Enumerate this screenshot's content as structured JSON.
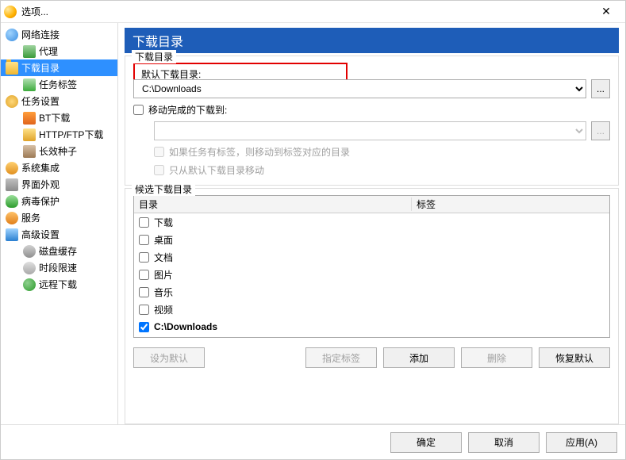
{
  "title": "选项...",
  "close_glyph": "✕",
  "sidebar": {
    "items": [
      {
        "label": "网络连接",
        "icon": "ic-globe",
        "level": 0
      },
      {
        "label": "代理",
        "icon": "ic-proxy",
        "level": 1
      },
      {
        "label": "下载目录",
        "icon": "ic-folder",
        "level": 0,
        "selected": true
      },
      {
        "label": "任务标签",
        "icon": "ic-tag",
        "level": 1
      },
      {
        "label": "任务设置",
        "icon": "ic-gear",
        "level": 0
      },
      {
        "label": "BT下载",
        "icon": "ic-bt",
        "level": 1
      },
      {
        "label": "HTTP/FTP下载",
        "icon": "ic-http",
        "level": 1
      },
      {
        "label": "长效种子",
        "icon": "ic-seed",
        "level": 1
      },
      {
        "label": "系统集成",
        "icon": "ic-users",
        "level": 0
      },
      {
        "label": "界面外观",
        "icon": "ic-ui",
        "level": 0
      },
      {
        "label": "病毒保护",
        "icon": "ic-shield",
        "level": 0
      },
      {
        "label": "服务",
        "icon": "ic-svc",
        "level": 0
      },
      {
        "label": "高级设置",
        "icon": "ic-adv",
        "level": 0
      },
      {
        "label": "磁盘缓存",
        "icon": "ic-disk",
        "level": 1
      },
      {
        "label": "时段限速",
        "icon": "ic-sched",
        "level": 1
      },
      {
        "label": "远程下载",
        "icon": "ic-remote",
        "level": 1
      }
    ]
  },
  "main": {
    "header": "下载目录",
    "group1": {
      "legend": "下载目录",
      "default_dir_label": "默认下载目录:",
      "default_dir_value": "C:\\Downloads",
      "browse_glyph": "...",
      "move_chk_label": "移动完成的下载到:",
      "move_chk_checked": false,
      "move_dir_value": "",
      "hint_move_tag": "如果任务有标签，则移动到标签对应的目录",
      "hint_move_default": "只从默认下载目录移动"
    },
    "group2": {
      "legend": "候选下载目录",
      "columns": {
        "dir": "目录",
        "tag": "标签"
      },
      "rows": [
        {
          "label": "下载",
          "checked": false
        },
        {
          "label": "桌面",
          "checked": false
        },
        {
          "label": "文档",
          "checked": false
        },
        {
          "label": "图片",
          "checked": false
        },
        {
          "label": "音乐",
          "checked": false
        },
        {
          "label": "视频",
          "checked": false
        },
        {
          "label": "C:\\Downloads",
          "checked": true,
          "bold": true
        }
      ],
      "buttons": {
        "set_default": "设为默认",
        "set_tag": "指定标签",
        "add": "添加",
        "delete": "删除",
        "restore": "恢复默认"
      }
    }
  },
  "footer": {
    "ok": "确定",
    "cancel": "取消",
    "apply": "应用(A)"
  }
}
